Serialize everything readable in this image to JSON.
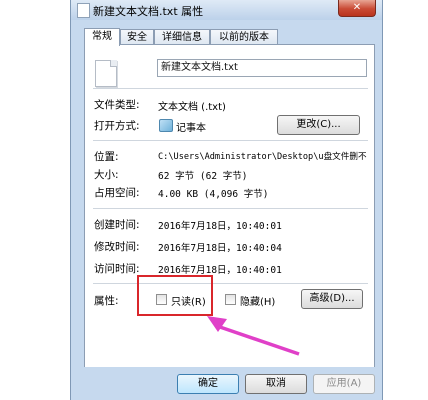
{
  "window": {
    "title": "新建文本文档.txt 属性",
    "close_label": "✕"
  },
  "tabs": [
    "常规",
    "安全",
    "详细信息",
    "以前的版本"
  ],
  "general": {
    "file_name": "新建文本文档.txt",
    "type_label": "文件类型:",
    "type_value": "文本文档 (.txt)",
    "opens_label": "打开方式:",
    "opens_value": "记事本",
    "change_button": "更改(C)...",
    "location_label": "位置:",
    "location_value": "C:\\Users\\Administrator\\Desktop\\u盘文件删不",
    "size_label": "大小:",
    "size_value": "62 字节 (62 字节)",
    "disk_label": "占用空间:",
    "disk_value": "4.00 KB (4,096 字节)",
    "created_label": "创建时间:",
    "created_value": "2016年7月18日，10:40:01",
    "modified_label": "修改时间:",
    "modified_value": "2016年7月18日，10:40:04",
    "accessed_label": "访问时间:",
    "accessed_value": "2016年7月18日，10:40:01",
    "attributes_label": "属性:",
    "readonly_label": "只读(R)",
    "hidden_label": "隐藏(H)",
    "advanced_button": "高级(D)..."
  },
  "footer": {
    "ok": "确定",
    "cancel": "取消",
    "apply": "应用(A)"
  },
  "colors": {
    "highlight": "#d9262b",
    "arrow": "#e040c8"
  }
}
